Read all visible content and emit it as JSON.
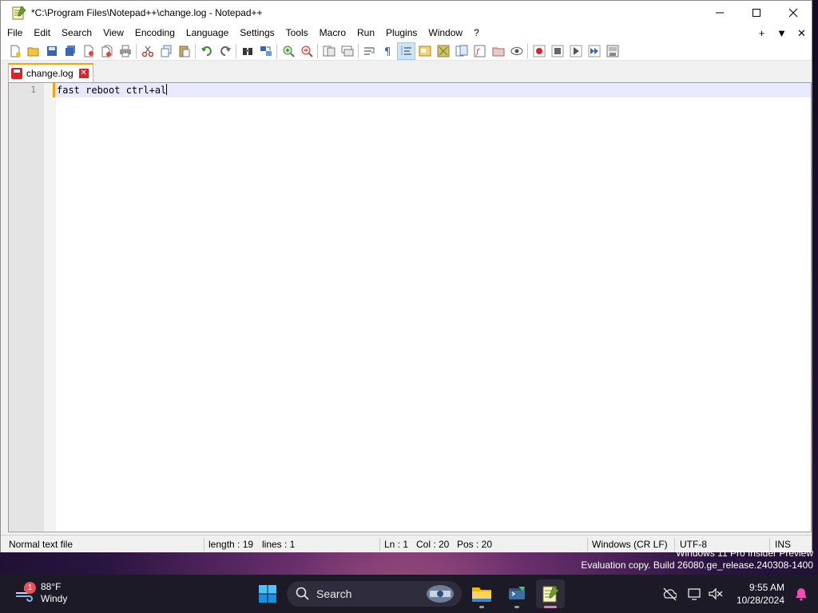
{
  "window": {
    "title": "*C:\\Program Files\\Notepad++\\change.log - Notepad++",
    "minimize_icon": "minimize-icon",
    "maximize_icon": "maximize-icon",
    "close_icon": "close-icon"
  },
  "menu": {
    "items": [
      "File",
      "Edit",
      "Search",
      "View",
      "Encoding",
      "Language",
      "Settings",
      "Tools",
      "Macro",
      "Run",
      "Plugins",
      "Window",
      "?"
    ],
    "right": [
      "+",
      "▼",
      "✕"
    ]
  },
  "toolbar": {
    "icons": [
      "new-file-icon",
      "open-file-icon",
      "save-icon",
      "save-all-icon",
      "close-icon",
      "close-all-icon",
      "print-icon",
      "cut-icon",
      "copy-icon",
      "paste-icon",
      "undo-icon",
      "redo-icon",
      "find-icon",
      "replace-icon",
      "zoom-in-icon",
      "zoom-out-icon",
      "sync-vertical-icon",
      "sync-horizontal-icon",
      "word-wrap-icon",
      "show-all-characters-icon",
      "indent-guide-icon",
      "user-defined-language-icon",
      "document-map-icon",
      "document-list-icon",
      "function-list-icon",
      "folder-as-workspace-icon",
      "monitoring-icon",
      "record-macro-icon",
      "stop-recording-icon",
      "play-macro-icon",
      "run-macro-multiple-icon",
      "save-macro-icon"
    ],
    "active": "indent-guide-icon"
  },
  "tab": {
    "label": "change.log",
    "modified": true
  },
  "editor": {
    "line_number": "1",
    "text": "fast reboot ctrl+al"
  },
  "statusbar": {
    "file_type": "Normal text file",
    "length": "length : 19",
    "lines": "lines : 1",
    "ln": "Ln : 1",
    "col": "Col : 20",
    "pos": "Pos : 20",
    "eol": "Windows (CR LF)",
    "encoding": "UTF-8",
    "mode": "INS"
  },
  "desktop": {
    "watermark_line1": "Windows 11 Pro Insider Preview",
    "watermark_line2": "Evaluation copy. Build 26080.ge_release.240308-1400"
  },
  "taskbar": {
    "weather_badge": "1",
    "temperature": "88°F",
    "condition": "Windy",
    "search_placeholder": "Search",
    "time": "9:55 AM",
    "date": "10/28/2024",
    "pinned": [
      "start-icon",
      "search-icon",
      "file-explorer-icon",
      "terminal-icon",
      "notepad-plus-plus-icon"
    ],
    "tray": [
      "onedrive-icon",
      "display-icon",
      "network-volume-icon",
      "notification-bell-icon"
    ]
  },
  "colors": {
    "tab_accent": "#f7a500",
    "current_line": "#e8e8ff",
    "taskbar_bg": "#1c1a26",
    "active_indicator": "#e87bb7"
  }
}
